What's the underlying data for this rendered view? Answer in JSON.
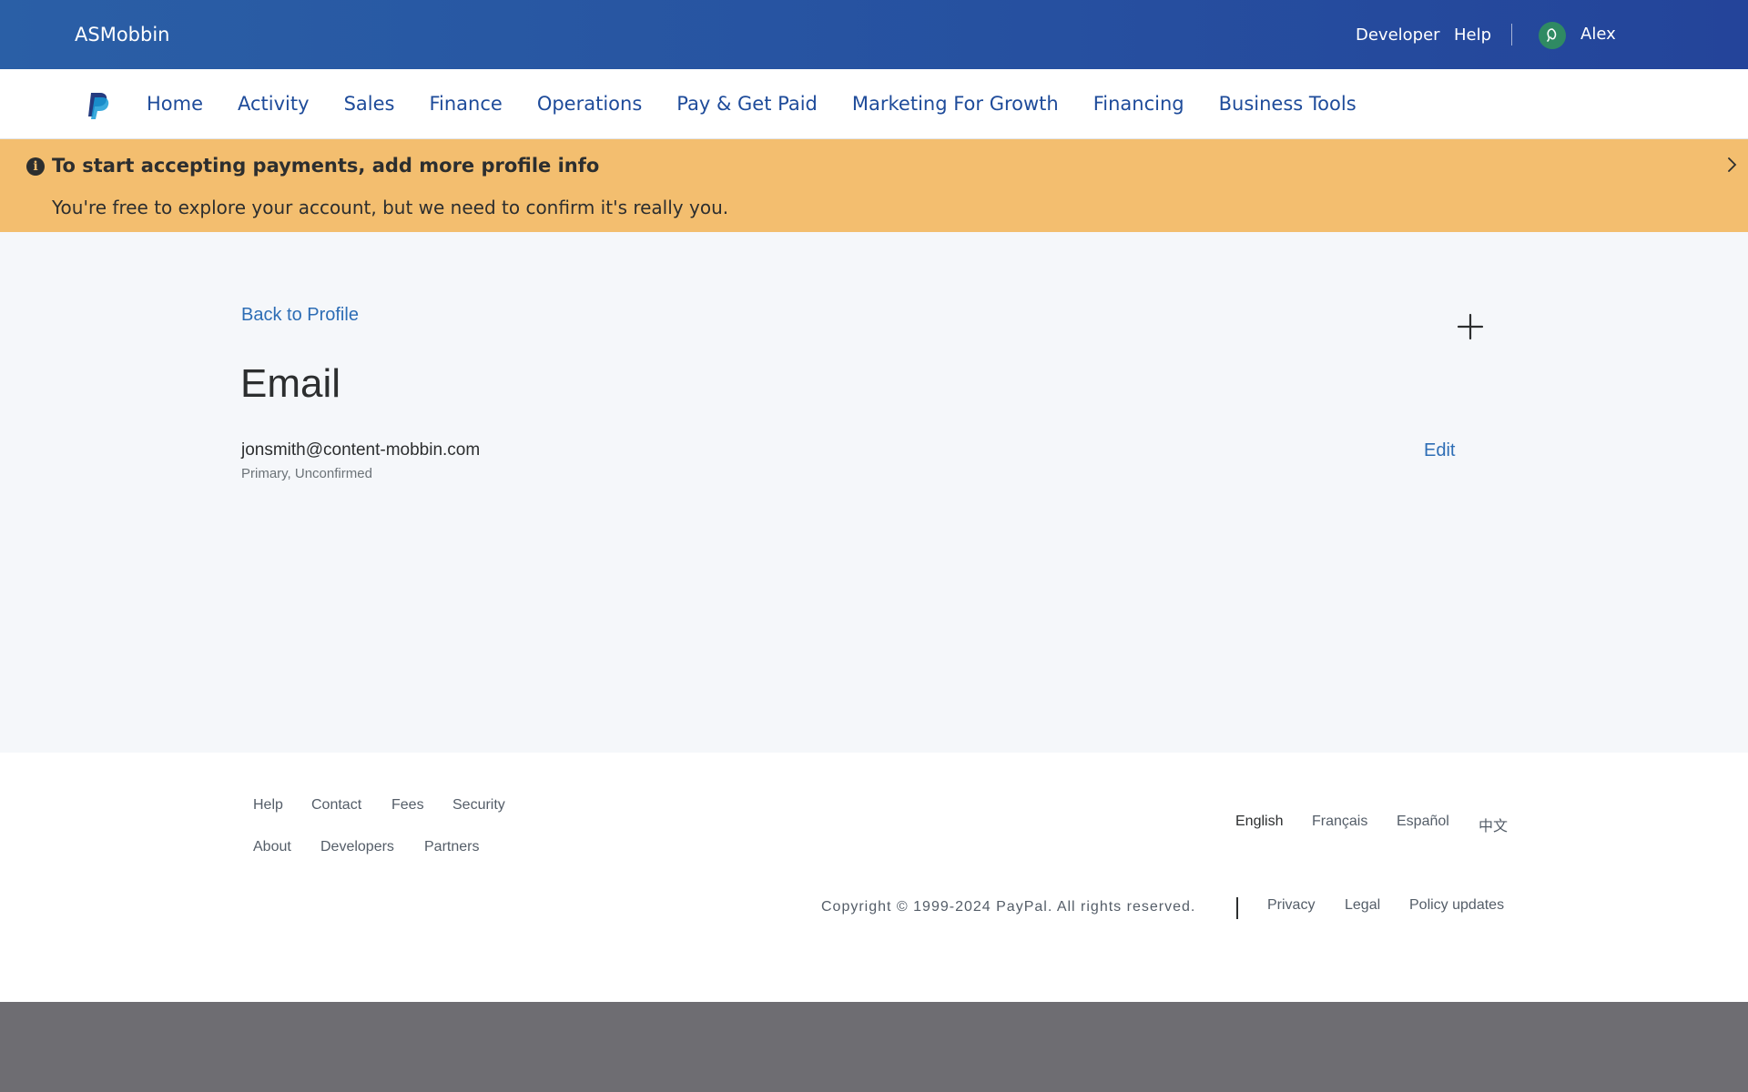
{
  "header": {
    "brand": "ASMobbin",
    "developer": "Developer",
    "help": "Help",
    "user_name": "Alex"
  },
  "nav": {
    "logo": "paypal-logo",
    "items": [
      {
        "label": "Home"
      },
      {
        "label": "Activity"
      },
      {
        "label": "Sales"
      },
      {
        "label": "Finance"
      },
      {
        "label": "Operations"
      },
      {
        "label": "Pay & Get Paid"
      },
      {
        "label": "Marketing For Growth"
      },
      {
        "label": "Financing"
      },
      {
        "label": "Business Tools"
      }
    ]
  },
  "banner": {
    "icon": "info-icon",
    "title": "To start accepting payments, add more profile info",
    "text": "You're free to explore your account, but we need to confirm it's really you."
  },
  "main": {
    "back_link": "Back to Profile",
    "title": "Email",
    "email": "jonsmith@content-mobbin.com",
    "status": "Primary, Unconfirmed",
    "edit": "Edit"
  },
  "footer": {
    "row1": [
      "Help",
      "Contact",
      "Fees",
      "Security"
    ],
    "row2": [
      "About",
      "Developers",
      "Partners"
    ],
    "languages": [
      "English",
      "Français",
      "Español",
      "中文"
    ],
    "copyright": "Copyright © 1999-2024 PayPal. All rights reserved.",
    "legal_links": [
      "Privacy",
      "Legal",
      "Policy updates"
    ]
  },
  "colors": {
    "header_bg": "#2650a0",
    "nav_text": "#1e4b9a",
    "banner_bg": "#f3be6f",
    "link": "#2d6db5",
    "page_bg": "#f5f7fa"
  }
}
